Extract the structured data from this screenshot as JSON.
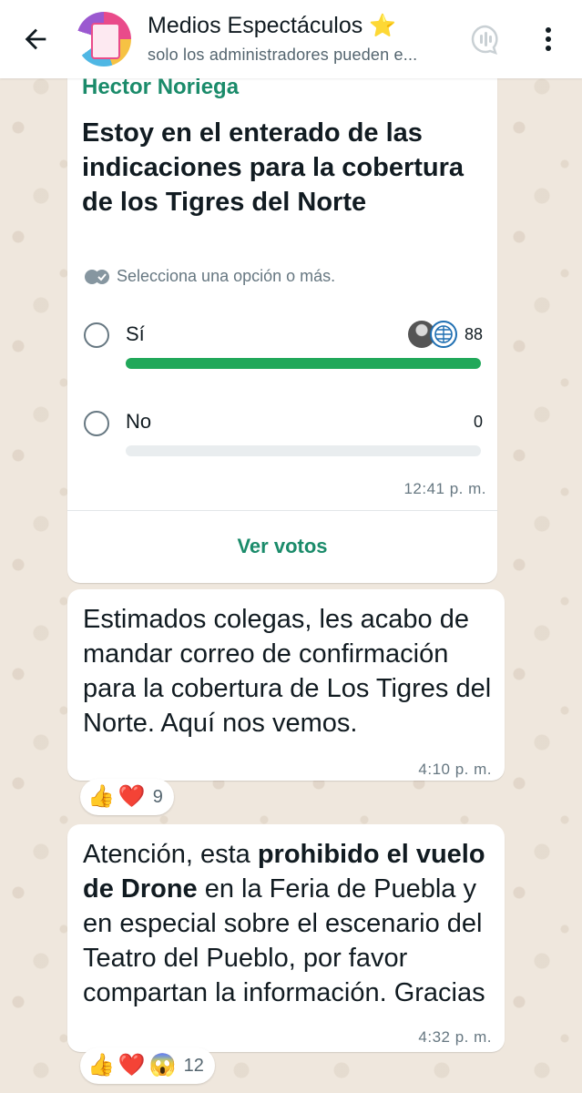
{
  "header": {
    "title": "Medios Espectáculos",
    "title_emoji": "⭐",
    "subtitle": "solo los administradores pueden e..."
  },
  "poll": {
    "sender": "Hector Noriega",
    "question": "Estoy en el enterado de las indicaciones para la cobertura de los Tigres del Norte",
    "hint": "Selecciona una opción o más.",
    "options": [
      {
        "label": "Sí",
        "count": "88",
        "fraction": 1.0
      },
      {
        "label": "No",
        "count": "0",
        "fraction": 0.0
      }
    ],
    "time": "12:41 p. m.",
    "view_votes": "Ver votos",
    "accent": "#21a85a"
  },
  "messages": [
    {
      "text": "Estimados colegas, les acabo de mandar correo de confirmación para la cobertura de Los Tigres del Norte. Aquí nos vemos.",
      "time": "4:10 p. m.",
      "reactions": {
        "emojis": [
          "👍",
          "❤️"
        ],
        "count": "9"
      }
    },
    {
      "text_parts": [
        "Atención, esta ",
        "prohibido el vuelo de Drone",
        " en la Feria de Puebla y en especial sobre el escenario del Teatro del Pueblo, por favor compartan la información. Gracias"
      ],
      "time": "4:32 p. m.",
      "reactions": {
        "emojis": [
          "👍",
          "❤️",
          "😱"
        ],
        "count": "12"
      }
    }
  ],
  "icons": {
    "back": "arrow-left-icon",
    "call": "voice-chat-icon",
    "menu": "more-vertical-icon",
    "double_check": "double-check-icon"
  }
}
